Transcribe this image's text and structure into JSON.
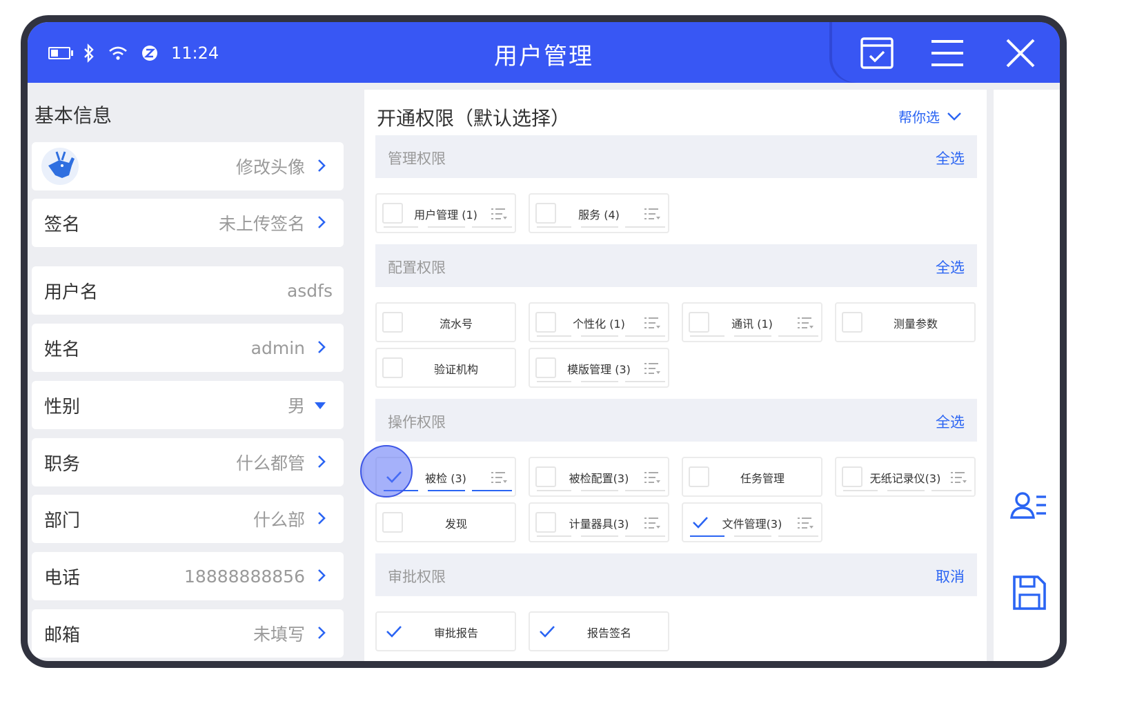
{
  "status": {
    "time": "11:24"
  },
  "header": {
    "title": "用户管理"
  },
  "left": {
    "section_title": "基本信息",
    "avatar_action": "修改头像",
    "rows": [
      {
        "label": "签名",
        "value": "未上传签名"
      },
      {
        "label": "用户名",
        "value": "asdfs"
      },
      {
        "label": "姓名",
        "value": "admin"
      },
      {
        "label": "性别",
        "value": "男"
      },
      {
        "label": "职务",
        "value": "什么都管"
      },
      {
        "label": "部门",
        "value": "什么部"
      },
      {
        "label": "电话",
        "value": "18888888856"
      },
      {
        "label": "邮箱",
        "value": "未填写"
      }
    ]
  },
  "permissions": {
    "title": "开通权限（默认选择）",
    "helper": "帮你选",
    "groups": [
      {
        "title": "管理权限",
        "action": "全选",
        "items": [
          {
            "label": "用户管理 (1)",
            "checked": false
          },
          {
            "label": "服务 (4)",
            "checked": false
          }
        ]
      },
      {
        "title": "配置权限",
        "action": "全选",
        "items": [
          {
            "label": "流水号",
            "checked": false
          },
          {
            "label": "个性化 (1)",
            "checked": false
          },
          {
            "label": "通讯 (1)",
            "checked": false
          },
          {
            "label": "测量参数",
            "checked": false
          },
          {
            "label": "验证机构",
            "checked": false
          },
          {
            "label": "模版管理 (3)",
            "checked": false
          }
        ]
      },
      {
        "title": "操作权限",
        "action": "全选",
        "items": [
          {
            "label": "被检 (3)",
            "checked": true
          },
          {
            "label": "被检配置(3)",
            "checked": false
          },
          {
            "label": "任务管理",
            "checked": false
          },
          {
            "label": "无纸记录仪(3)",
            "checked": false
          },
          {
            "label": "发现",
            "checked": false
          },
          {
            "label": "计量器具(3)",
            "checked": false
          },
          {
            "label": "文件管理(3)",
            "checked": true
          }
        ]
      },
      {
        "title": "审批权限",
        "action": "取消",
        "items": [
          {
            "label": "审批报告",
            "checked": true
          },
          {
            "label": "报告签名",
            "checked": true
          }
        ]
      }
    ]
  },
  "colors": {
    "primary": "#3857f4",
    "accent": "#2a64f3",
    "frame": "#31333f"
  }
}
